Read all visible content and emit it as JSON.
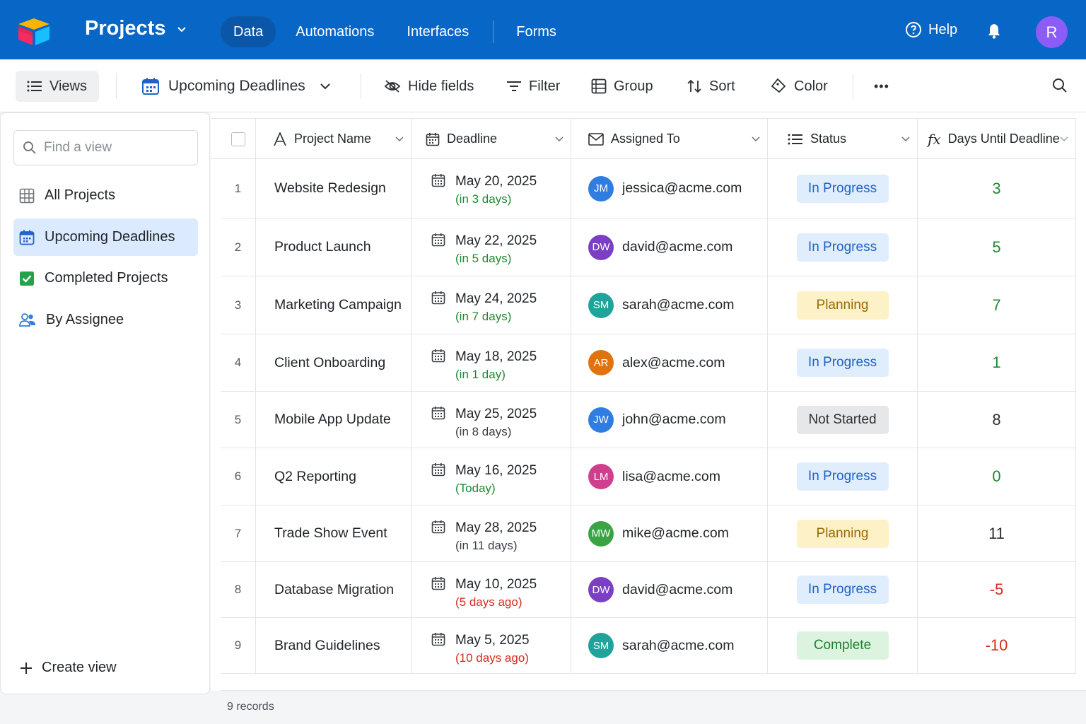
{
  "header": {
    "base_name": "Projects",
    "tabs": [
      {
        "label": "Data",
        "active": true
      },
      {
        "label": "Automations",
        "active": false
      },
      {
        "label": "Interfaces",
        "active": false
      },
      {
        "label": "Forms",
        "active": false
      }
    ],
    "help_label": "Help",
    "user_initial": "R",
    "brand_color": "#0866c6",
    "icons": [
      "logo-icon",
      "chevron-down-icon",
      "help-circle-icon",
      "bell-icon"
    ]
  },
  "toolbar": {
    "views_label": "Views",
    "current_view": "Upcoming Deadlines",
    "hide_fields": "Hide fields",
    "filter": "Filter",
    "group": "Group",
    "sort": "Sort",
    "color": "Color",
    "more": "•••"
  },
  "sidebar": {
    "search_placeholder": "Find a view",
    "views": [
      {
        "label": "All Projects",
        "icon": "grid-icon",
        "active": false
      },
      {
        "label": "Upcoming Deadlines",
        "icon": "calendar-icon",
        "active": true
      },
      {
        "label": "Completed Projects",
        "icon": "checkbox-checked-icon",
        "active": false
      },
      {
        "label": "By Assignee",
        "icon": "people-icon",
        "active": false
      }
    ],
    "create_view": "Create view"
  },
  "table": {
    "columns": [
      {
        "label": "Project Name",
        "icon": "text-field-icon"
      },
      {
        "label": "Deadline",
        "icon": "calendar-field-icon"
      },
      {
        "label": "Assigned To",
        "icon": "email-field-icon"
      },
      {
        "label": "Status",
        "icon": "list-field-icon"
      },
      {
        "label": "Days Until Deadline",
        "icon": "formula-field-icon"
      }
    ],
    "rows": [
      {
        "num": "1",
        "name": "Website Redesign",
        "date": "May 20, 2025",
        "rel": "(in 3 days)",
        "rel_color": "#1e8a2f",
        "initials": "JM",
        "av_color": "#2f7de1",
        "email": "jessica@acme.com",
        "status": "In Progress",
        "days": "3",
        "days_color": "#1e8a2f"
      },
      {
        "num": "2",
        "name": "Product Launch",
        "date": "May 22, 2025",
        "rel": "(in 5 days)",
        "rel_color": "#1e8a2f",
        "initials": "DW",
        "av_color": "#7a3fc2",
        "email": "david@acme.com",
        "status": "In Progress",
        "days": "5",
        "days_color": "#1e8a2f"
      },
      {
        "num": "3",
        "name": "Marketing Campaign",
        "date": "May 24, 2025",
        "rel": "(in 7 days)",
        "rel_color": "#1e8a2f",
        "initials": "SM",
        "av_color": "#1fa39a",
        "email": "sarah@acme.com",
        "status": "Planning",
        "days": "7",
        "days_color": "#1e8a2f"
      },
      {
        "num": "4",
        "name": "Client Onboarding",
        "date": "May 18, 2025",
        "rel": "(in 1 day)",
        "rel_color": "#1e8a2f",
        "initials": "AR",
        "av_color": "#e0730f",
        "email": "alex@acme.com",
        "status": "In Progress",
        "days": "1",
        "days_color": "#1e8a2f"
      },
      {
        "num": "5",
        "name": "Mobile App Update",
        "date": "May 25, 2025",
        "rel": "(in 8 days)",
        "rel_color": "#3a3f44",
        "initials": "JW",
        "av_color": "#2f7de1",
        "email": "john@acme.com",
        "status": "Not Started",
        "days": "8",
        "days_color": "#2b2f33"
      },
      {
        "num": "6",
        "name": "Q2 Reporting",
        "date": "May 16, 2025",
        "rel": "(Today)",
        "rel_color": "#1e8a2f",
        "initials": "LM",
        "av_color": "#cf3f8e",
        "email": "lisa@acme.com",
        "status": "In Progress",
        "days": "0",
        "days_color": "#1e8a2f"
      },
      {
        "num": "7",
        "name": "Trade Show Event",
        "date": "May 28, 2025",
        "rel": "(in 11 days)",
        "rel_color": "#3a3f44",
        "initials": "MW",
        "av_color": "#3aa444",
        "email": "mike@acme.com",
        "status": "Planning",
        "days": "11",
        "days_color": "#2b2f33"
      },
      {
        "num": "8",
        "name": "Database Migration",
        "date": "May 10, 2025",
        "rel": "(5 days ago)",
        "rel_color": "#d52b1e",
        "initials": "DW",
        "av_color": "#7a3fc2",
        "email": "david@acme.com",
        "status": "In Progress",
        "days": "-5",
        "days_color": "#d52b1e"
      },
      {
        "num": "9",
        "name": "Brand Guidelines",
        "date": "May 5, 2025",
        "rel": "(10 days ago)",
        "rel_color": "#d52b1e",
        "initials": "SM",
        "av_color": "#1fa39a",
        "email": "sarah@acme.com",
        "status": "Complete",
        "days": "-10",
        "days_color": "#d52b1e"
      }
    ],
    "status_styles": {
      "In Progress": {
        "bg": "#e0edfd",
        "fg": "#1f63c9"
      },
      "Planning": {
        "bg": "#fdf1c8",
        "fg": "#9a6b00"
      },
      "Not Started": {
        "bg": "#e6e7e9",
        "fg": "#2b2f33"
      },
      "Complete": {
        "bg": "#dcf4df",
        "fg": "#1e7f30"
      }
    },
    "records_label": "9 records"
  }
}
